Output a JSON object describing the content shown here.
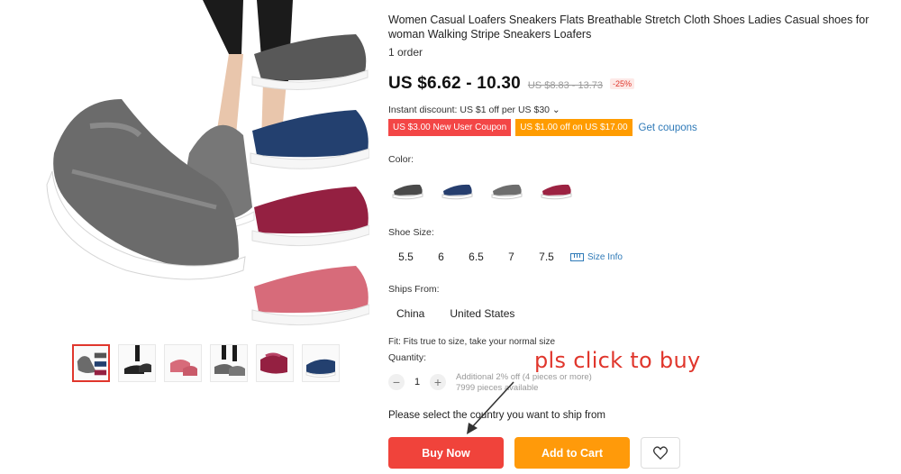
{
  "product": {
    "title": "Women Casual Loafers Sneakers Flats Breathable Stretch Cloth Shoes Ladies Casual shoes for woman Walking Stripe Sneakers Loafers",
    "orders": "1 order",
    "price": "US $6.62 - 10.30",
    "original_price": "US $8.83 - 13.73",
    "discount": "-25%"
  },
  "promotions": {
    "instant_discount": "Instant discount: US $1 off per US $30 ⌄",
    "coupons": [
      "US $3.00 New User Coupon",
      "US $1.00 off on US $17.00"
    ],
    "get_coupons_label": "Get coupons"
  },
  "color": {
    "label": "Color:",
    "options": [
      {
        "name": "gray-black",
        "hex": "#4a4a4a"
      },
      {
        "name": "navy-blue",
        "hex": "#263e6e"
      },
      {
        "name": "gray",
        "hex": "#6d6d6d"
      },
      {
        "name": "wine-red",
        "hex": "#9c2242"
      }
    ]
  },
  "shoe_size": {
    "label": "Shoe Size:",
    "options": [
      "5.5",
      "6",
      "6.5",
      "7",
      "7.5"
    ],
    "size_info_label": "Size Info"
  },
  "ships_from": {
    "label": "Ships From:",
    "options": [
      "China",
      "United States"
    ]
  },
  "fit": "Fit: Fits true to size, take your normal size",
  "quantity": {
    "label": "Quantity:",
    "value": "1",
    "minus": "−",
    "plus": "+",
    "note_line1": "Additional 2% off (4 pieces or more)",
    "note_line2": "7999 pieces available"
  },
  "ship_note": "Please select the country you want to ship from",
  "actions": {
    "buy_now": "Buy Now",
    "add_to_cart": "Add to Cart"
  },
  "annotation": "pls click to buy",
  "colors": {
    "buy_now": "#f0433b",
    "add_to_cart": "#ff9a0a",
    "coupon_red": "#f34646",
    "coupon_orange": "#ff9c00",
    "link": "#2f7ab8",
    "annotation": "#e0362c"
  },
  "gallery": {
    "thumbnails": [
      "gray-pair",
      "black-on-feet",
      "pink-on-feet",
      "gray-on-feet",
      "wine-red-pair",
      "blue-pair"
    ]
  }
}
